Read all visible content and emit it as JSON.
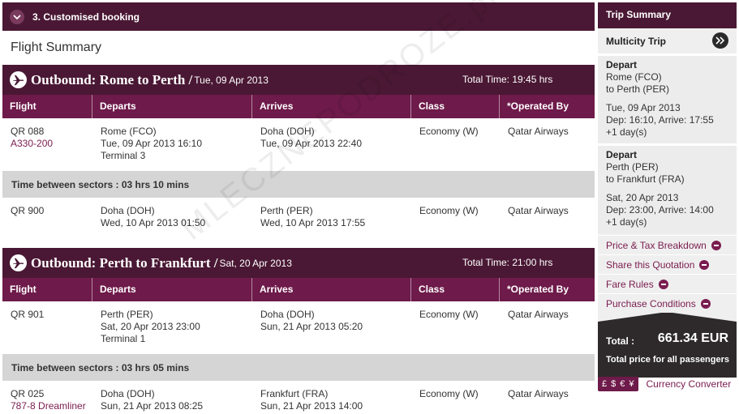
{
  "step": {
    "title": "3. Customised booking"
  },
  "page_title": "Flight Summary",
  "columns": {
    "flight": "Flight",
    "departs": "Departs",
    "arrives": "Arrives",
    "class": "Class",
    "operated": "*Operated By"
  },
  "legs": [
    {
      "title": "Outbound: Rome  to Perth /",
      "date": "Tue, 09 Apr 2013",
      "total": "Total Time: 19:45 hrs",
      "segments": [
        {
          "flight": "QR 088",
          "aircraft": "A330-200",
          "dep_place": "Rome (FCO)",
          "dep_time": "Tue, 09 Apr 2013 16:10",
          "dep_terminal": "Terminal 3",
          "arr_place": "Doha (DOH)",
          "arr_time": "Tue, 09 Apr 2013 22:40",
          "class": "Economy (W)",
          "operator": "Qatar Airways"
        },
        {
          "flight": "QR 900",
          "aircraft": "",
          "dep_place": "Doha (DOH)",
          "dep_time": "Wed, 10 Apr 2013 01:50",
          "dep_terminal": "",
          "arr_place": "Perth (PER)",
          "arr_time": "Wed, 10 Apr 2013 17:55",
          "class": "Economy (W)",
          "operator": "Qatar Airways"
        }
      ],
      "between": "Time between sectors : 03 hrs 10 mins"
    },
    {
      "title": "Outbound: Perth  to Frankfurt /",
      "date": "Sat, 20 Apr 2013",
      "total": "Total Time: 21:00 hrs",
      "segments": [
        {
          "flight": "QR 901",
          "aircraft": "",
          "dep_place": "Perth (PER)",
          "dep_time": "Sat, 20 Apr 2013 23:00",
          "dep_terminal": "Terminal 1",
          "arr_place": "Doha (DOH)",
          "arr_time": "Sun, 21 Apr 2013 05:20",
          "class": "Economy (W)",
          "operator": "Qatar Airways"
        },
        {
          "flight": "QR 025",
          "aircraft": "787-8 Dreamliner",
          "dep_place": "Doha (DOH)",
          "dep_time": "Sun, 21 Apr 2013 08:25",
          "dep_terminal": "",
          "arr_place": "Frankfurt (FRA)",
          "arr_time": "Sun, 21 Apr 2013 14:00",
          "class": "Economy (W)",
          "operator": "Qatar Airways"
        }
      ],
      "between": "Time between sectors : 03 hrs 05 mins"
    }
  ],
  "sidebar": {
    "title": "Trip Summary",
    "trip_type": "Multicity Trip",
    "trips": [
      {
        "label": "Depart",
        "from": "Rome (FCO)",
        "to": "to Perth (PER)",
        "date": "Tue, 09 Apr 2013",
        "times": "Dep: 16:10, Arrive: 17:55",
        "extra": "+1 day(s)"
      },
      {
        "label": "Depart",
        "from": "Perth (PER)",
        "to": "to Frankfurt (FRA)",
        "date": "Sat, 20 Apr 2013",
        "times": "Dep: 23:00, Arrive: 14:00",
        "extra": "+1 day(s)"
      }
    ],
    "links": [
      "Price & Tax Breakdown",
      "Share this Quotation",
      "Fare Rules",
      "Purchase Conditions"
    ],
    "total_label": "Total :",
    "total_value": "661.34 EUR",
    "total_note": "Total price for all passengers"
  },
  "converter": {
    "symbols": [
      "£",
      "$",
      "€",
      "¥"
    ],
    "label": "Currency Converter"
  },
  "watermark": "MLECZNEPODROZE.pl",
  "colors": {
    "brand_dark": "#4a1834",
    "brand": "#6e1a4a",
    "accent_text": "#7a1c4f",
    "sector_bg": "#d5d5d5"
  }
}
